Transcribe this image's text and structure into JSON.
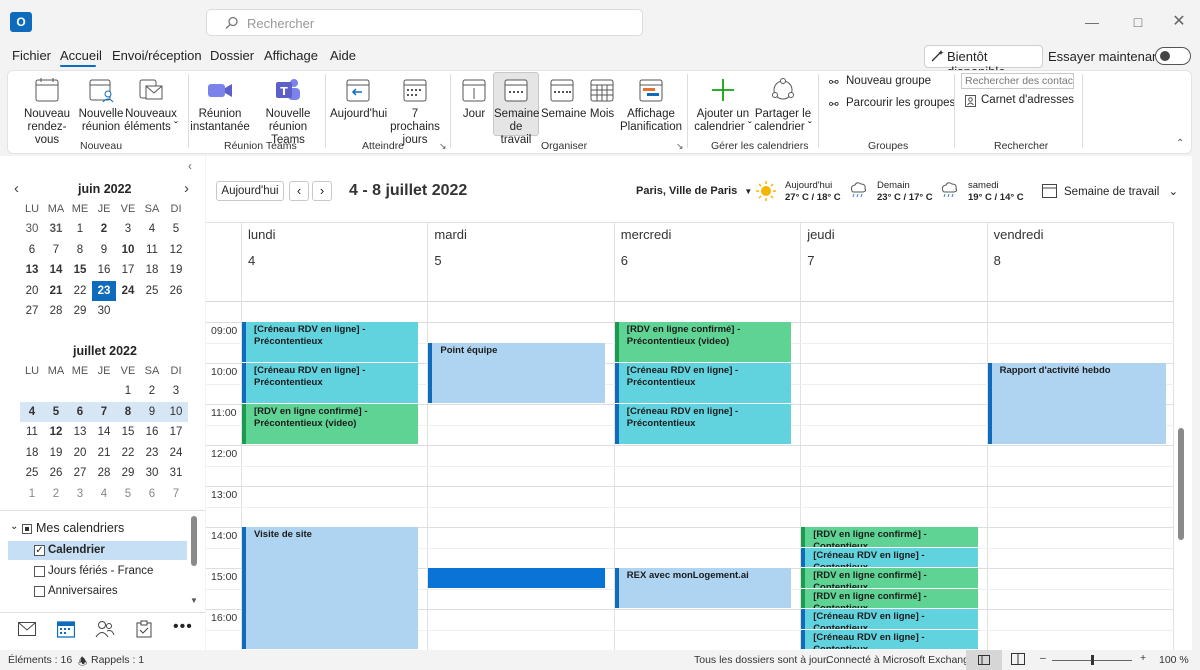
{
  "app": {
    "logo_letter": "O"
  },
  "search": {
    "placeholder": "Rechercher"
  },
  "menu": {
    "items": [
      "Fichier",
      "Accueil",
      "Envoi/réception",
      "Dossier",
      "Affichage",
      "Aide"
    ],
    "bientot": "Bientôt disponible",
    "essayer": "Essayer maintenant"
  },
  "ribbon": {
    "nouveau": {
      "rdv1": "Nouveau",
      "rdv2": "rendez-vous",
      "reu1": "Nouvelle",
      "reu2": "réunion",
      "el1": "Nouveaux",
      "el2": "éléments",
      "group": "Nouveau"
    },
    "teams": {
      "inst1": "Réunion",
      "inst2": "instantanée",
      "nt1": "Nouvelle",
      "nt2": "réunion Teams",
      "group": "Réunion Teams"
    },
    "atteindre": {
      "auj": "Aujourd'hui",
      "sept1": "7 prochains",
      "sept2": "jours",
      "group": "Atteindre"
    },
    "organiser": {
      "jour": "Jour",
      "sdt1": "Semaine",
      "sdt2": "de travail",
      "sem": "Semaine",
      "mois": "Mois",
      "aff1": "Affichage",
      "aff2": "Planification",
      "group": "Organiser"
    },
    "gerer": {
      "aj1": "Ajouter un",
      "aj2": "calendrier",
      "pa1": "Partager le",
      "pa2": "calendrier",
      "group": "Gérer les calendriers"
    },
    "groupes": {
      "nouveau": "Nouveau groupe",
      "parcourir": "Parcourir les groupes",
      "group": "Groupes"
    },
    "rechercher": {
      "contacts": "Rechercher des contacts",
      "carnet": "Carnet d'adresses",
      "group": "Rechercher"
    }
  },
  "minical": {
    "weekdays": [
      "LU",
      "MA",
      "ME",
      "JE",
      "VE",
      "SA",
      "DI"
    ],
    "june": {
      "title": "juin 2022",
      "weeks": [
        [
          "30",
          "31",
          "1",
          "2",
          "3",
          "4",
          "5"
        ],
        [
          "6",
          "7",
          "8",
          "9",
          "10",
          "11",
          "12"
        ],
        [
          "13",
          "14",
          "15",
          "16",
          "17",
          "18",
          "19"
        ],
        [
          "20",
          "21",
          "22",
          "23",
          "24",
          "25",
          "26"
        ],
        [
          "27",
          "28",
          "29",
          "30",
          "",
          "",
          ""
        ]
      ],
      "bold": [
        "31",
        "2",
        "10",
        "13",
        "14",
        "15",
        "21",
        "24"
      ],
      "today": "23"
    },
    "july": {
      "title": "juillet 2022",
      "weeks": [
        [
          "",
          "",
          "",
          "",
          "1",
          "2",
          "3"
        ],
        [
          "4",
          "5",
          "6",
          "7",
          "8",
          "9",
          "10"
        ],
        [
          "11",
          "12",
          "13",
          "14",
          "15",
          "16",
          "17"
        ],
        [
          "18",
          "19",
          "20",
          "21",
          "22",
          "23",
          "24"
        ],
        [
          "25",
          "26",
          "27",
          "28",
          "29",
          "30",
          "31"
        ],
        [
          "1",
          "2",
          "3",
          "4",
          "5",
          "6",
          "7"
        ]
      ],
      "bold": [
        "4",
        "5",
        "6",
        "7",
        "8",
        "12"
      ]
    }
  },
  "calendars": {
    "header": "Mes calendriers",
    "items": [
      {
        "label": "Calendrier",
        "checked": true,
        "selected": true
      },
      {
        "label": "Jours fériés - France",
        "checked": false,
        "selected": false
      },
      {
        "label": "Anniversaires",
        "checked": false,
        "selected": false
      }
    ]
  },
  "toolbar": {
    "today_button": "Aujourd'hui",
    "range": "4 - 8 juillet 2022",
    "location": "Paris, Ville de Paris",
    "weather": [
      {
        "label": "Aujourd'hui",
        "temps": "27° C / 18° C",
        "icon": "sun-icon"
      },
      {
        "label": "Demain",
        "temps": "23° C / 17° C",
        "icon": "rain-icon"
      },
      {
        "label": "samedi",
        "temps": "19° C / 14° C",
        "icon": "rain-icon"
      }
    ],
    "view": "Semaine de travail"
  },
  "days": [
    {
      "name": "lundi",
      "num": "4"
    },
    {
      "name": "mardi",
      "num": "5"
    },
    {
      "name": "mercredi",
      "num": "6"
    },
    {
      "name": "jeudi",
      "num": "7"
    },
    {
      "name": "vendredi",
      "num": "8"
    }
  ],
  "hours": [
    "09:00",
    "10:00",
    "11:00",
    "12:00",
    "13:00",
    "14:00",
    "15:00",
    "16:00"
  ],
  "events": [
    {
      "day": 0,
      "start": 9.0,
      "end": 10.0,
      "color": "teal",
      "title": "[Créneau RDV en ligne] - Précontentieux"
    },
    {
      "day": 0,
      "start": 10.0,
      "end": 11.0,
      "color": "teal",
      "title": "[Créneau RDV en ligne] - Précontentieux"
    },
    {
      "day": 0,
      "start": 11.0,
      "end": 12.0,
      "color": "green",
      "title": "[RDV en ligne confirmé] - Précontentieux (video)"
    },
    {
      "day": 0,
      "start": 14.0,
      "end": 17.0,
      "color": "blue",
      "title": "Visite de site"
    },
    {
      "day": 1,
      "start": 9.5,
      "end": 11.0,
      "color": "blue",
      "title": "Point équipe"
    },
    {
      "day": 1,
      "start": 15.0,
      "end": 15.5,
      "color": "dark",
      "title": ""
    },
    {
      "day": 2,
      "start": 9.0,
      "end": 10.0,
      "color": "green",
      "title": "[RDV en ligne confirmé] - Précontentieux (video)"
    },
    {
      "day": 2,
      "start": 10.0,
      "end": 11.0,
      "color": "teal",
      "title": "[Créneau RDV en ligne] - Précontentieux"
    },
    {
      "day": 2,
      "start": 11.0,
      "end": 12.0,
      "color": "teal",
      "title": "[Créneau RDV en ligne] - Précontentieux"
    },
    {
      "day": 2,
      "start": 15.0,
      "end": 16.0,
      "color": "blue",
      "title": "REX avec monLogement.ai"
    },
    {
      "day": 3,
      "start": 14.0,
      "end": 14.5,
      "color": "green",
      "title": "[RDV en ligne confirmé] - Contentieux"
    },
    {
      "day": 3,
      "start": 14.5,
      "end": 15.0,
      "color": "teal",
      "title": "[Créneau RDV en ligne] - Contentieux"
    },
    {
      "day": 3,
      "start": 15.0,
      "end": 15.5,
      "color": "green",
      "title": "[RDV en ligne confirmé] - Contentieux"
    },
    {
      "day": 3,
      "start": 15.5,
      "end": 16.0,
      "color": "green",
      "title": "[RDV en ligne confirmé] - Contentieux"
    },
    {
      "day": 3,
      "start": 16.0,
      "end": 16.5,
      "color": "teal",
      "title": "[Créneau RDV en ligne] - Contentieux"
    },
    {
      "day": 3,
      "start": 16.5,
      "end": 17.0,
      "color": "teal",
      "title": "[Créneau RDV en ligne] - Contentieux"
    },
    {
      "day": 4,
      "start": 10.0,
      "end": 12.0,
      "color": "blue",
      "title": "Rapport d'activité hebdo"
    }
  ],
  "status": {
    "elements": "Éléments : 16",
    "rappels": "Rappels : 1",
    "dossiers": "Tous les dossiers sont à jour.",
    "connexion": "Connecté à Microsoft Exchange",
    "zoom": "100 %"
  },
  "colors": {
    "accent": "#0f6cbd",
    "teal": "#60d3df",
    "green": "#5ed393",
    "light_blue": "#aed4f2"
  }
}
